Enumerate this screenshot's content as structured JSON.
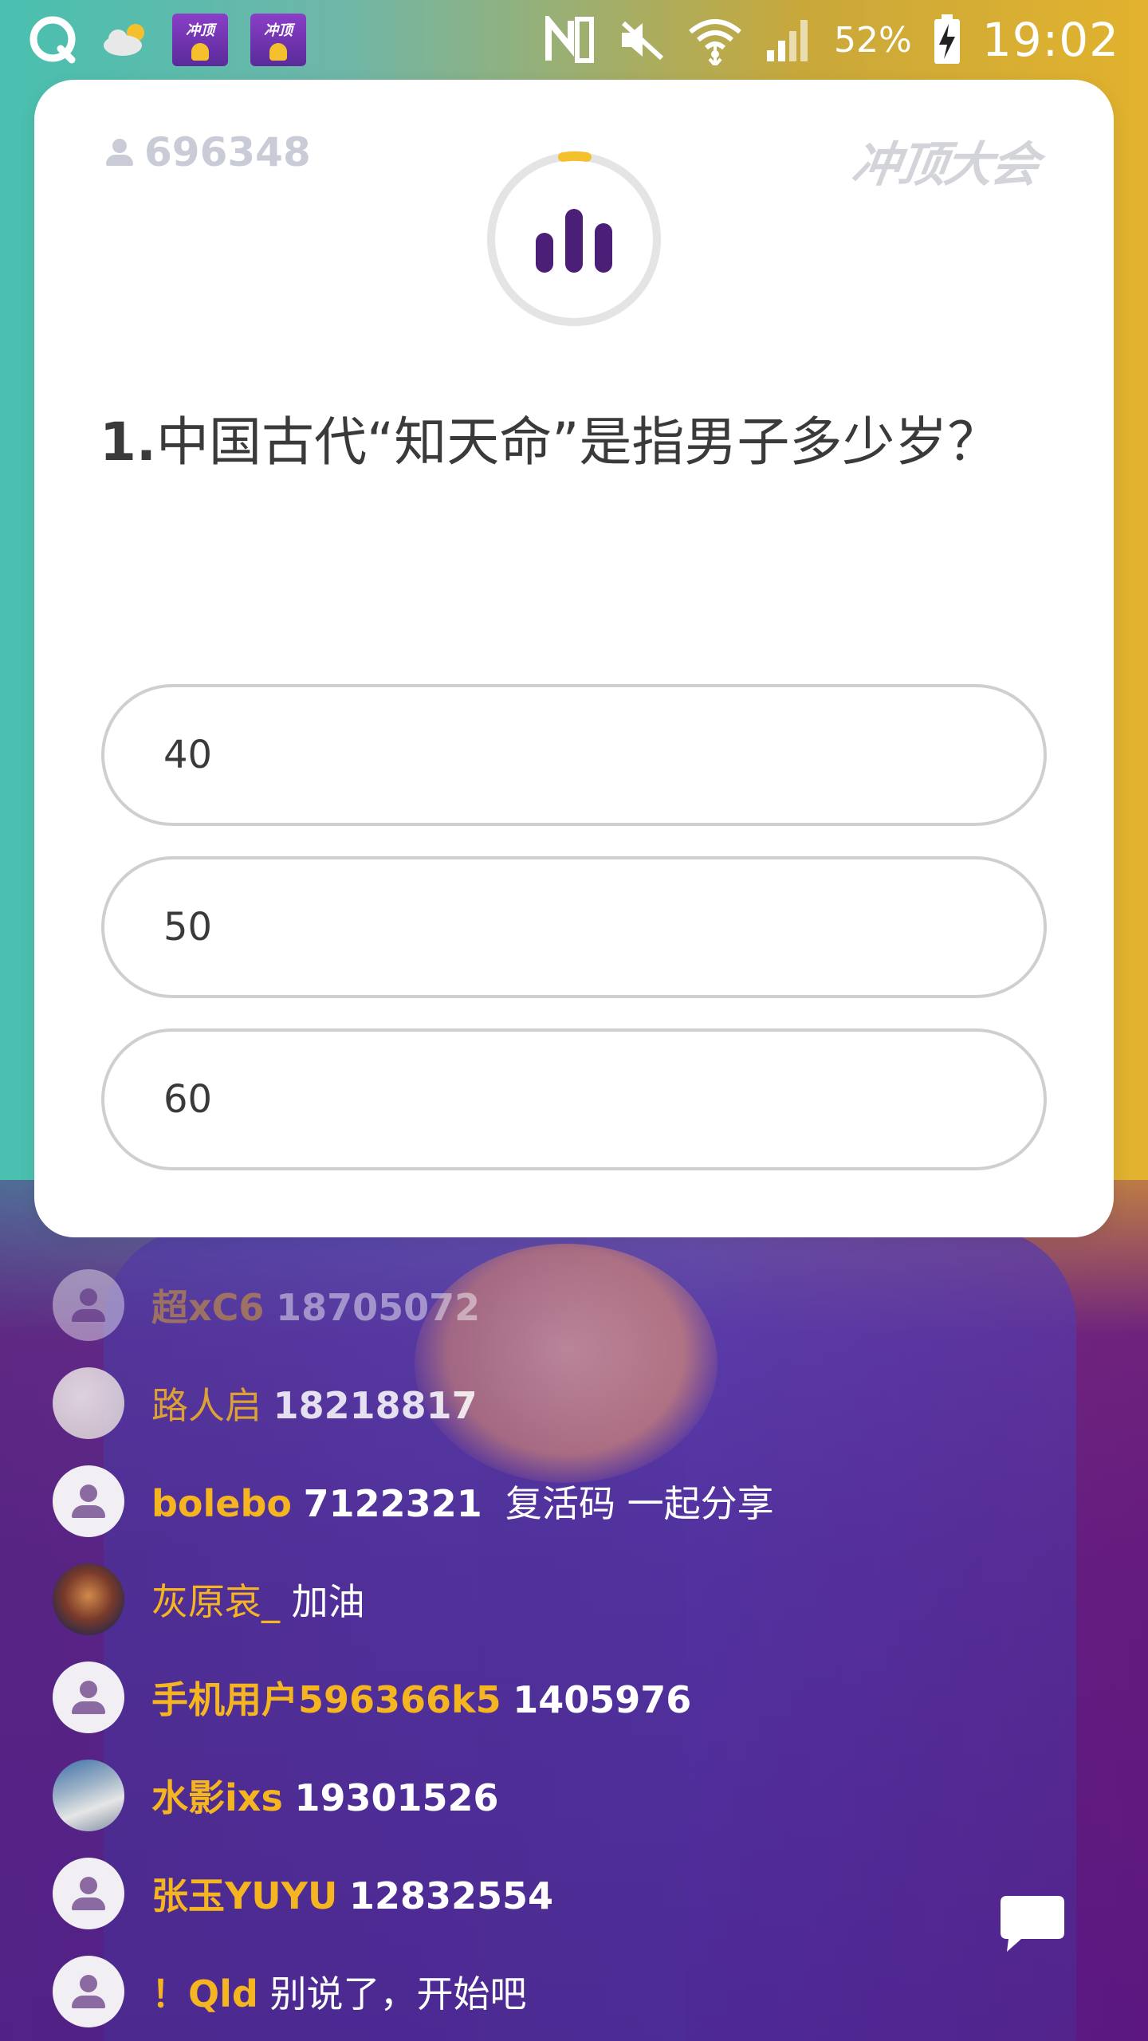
{
  "status_bar": {
    "battery": "52%",
    "time": "19:02",
    "app_icon_label": "冲顶",
    "icons": [
      "q-app-icon",
      "cloudy-weather-icon",
      "nfc-icon",
      "mute-icon",
      "wifi-icon",
      "signal-icon",
      "battery-charging-icon"
    ]
  },
  "card": {
    "viewer_count": "696348",
    "brand": "冲顶大会",
    "question_number": "1.",
    "question_text": "中国古代“知天命”是指男子多少岁？",
    "options": [
      "40",
      "50",
      "60"
    ]
  },
  "chat": [
    {
      "user": "超xC6",
      "message": "18705072",
      "avatar": "placeholder"
    },
    {
      "user": "路人启",
      "message": "18218817",
      "avatar": "sketch"
    },
    {
      "user": "bolebo",
      "message": "7122321",
      "extra": "复活码  一起分享",
      "avatar": "placeholder"
    },
    {
      "user": "灰原哀_",
      "message": "加油",
      "avatar": "anime"
    },
    {
      "user": "手机用户596366k5",
      "message": "1405976",
      "avatar": "placeholder"
    },
    {
      "user": "水影ixs",
      "message": "19301526",
      "avatar": "snow"
    },
    {
      "user": "张玉YUYU",
      "message": "12832554",
      "avatar": "placeholder"
    },
    {
      "user": "！Qld",
      "message": "别说了，开始吧",
      "avatar": "placeholder"
    }
  ],
  "colors": {
    "username": "#f5b521",
    "timer_ring": "#e4e4e4",
    "timer_progress": "#f5c02d",
    "timer_icon": "#4b1f78"
  }
}
